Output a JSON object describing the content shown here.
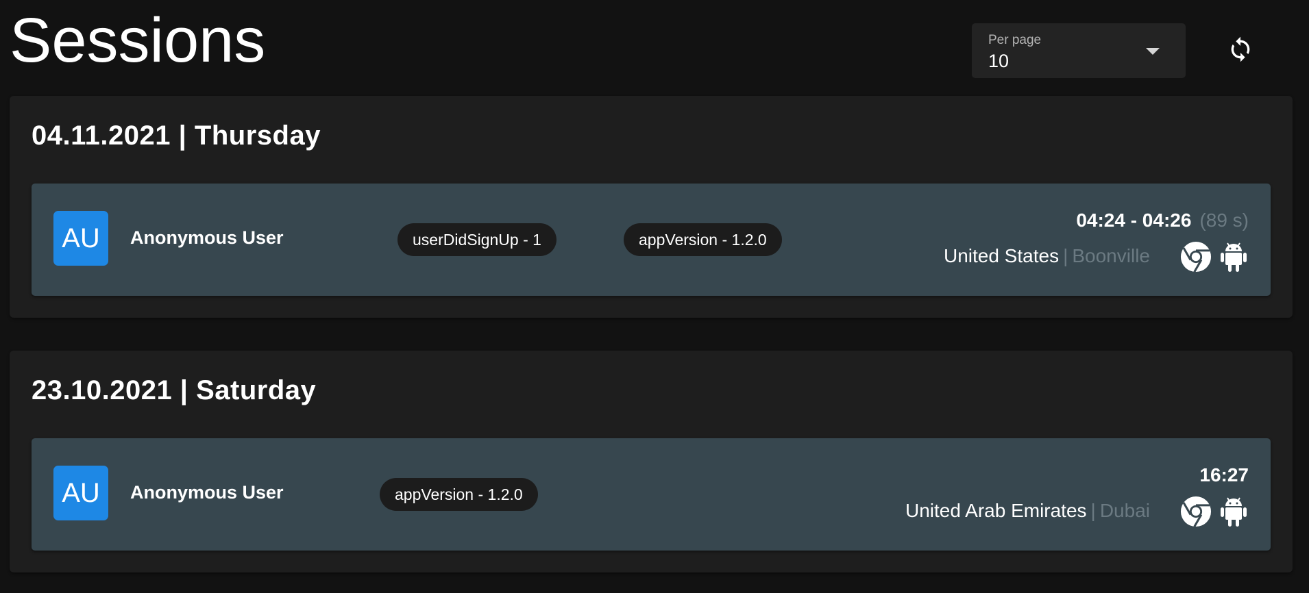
{
  "header": {
    "title": "Sessions",
    "per_page_label": "Per page",
    "per_page_value": "10",
    "refresh_icon": "refresh-icon"
  },
  "days": [
    {
      "heading": "04.11.2021 | Thursday",
      "session": {
        "avatar_initials": "AU",
        "user_name": "Anonymous User",
        "chips": [
          "userDidSignUp - 1",
          "appVersion - 1.2.0"
        ],
        "time_range": "04:24 - 04:26",
        "duration": "(89 s)",
        "country": "United States",
        "separator": "|",
        "city": "Boonville",
        "browser_icon": "chrome-icon",
        "os_icon": "android-icon"
      }
    },
    {
      "heading": "23.10.2021 | Saturday",
      "session": {
        "avatar_initials": "AU",
        "user_name": "Anonymous User",
        "chips": [
          "appVersion - 1.2.0"
        ],
        "time_range": "16:27",
        "duration": "",
        "country": "United Arab Emirates",
        "separator": "|",
        "city": "Dubai",
        "browser_icon": "chrome-icon",
        "os_icon": "android-icon"
      }
    }
  ],
  "colors": {
    "background": "#121212",
    "card": "#1e1e1e",
    "session_row": "#37474f",
    "avatar": "#1e88e5",
    "chip": "#1c1c1c",
    "muted_text": "#6b7a82"
  }
}
